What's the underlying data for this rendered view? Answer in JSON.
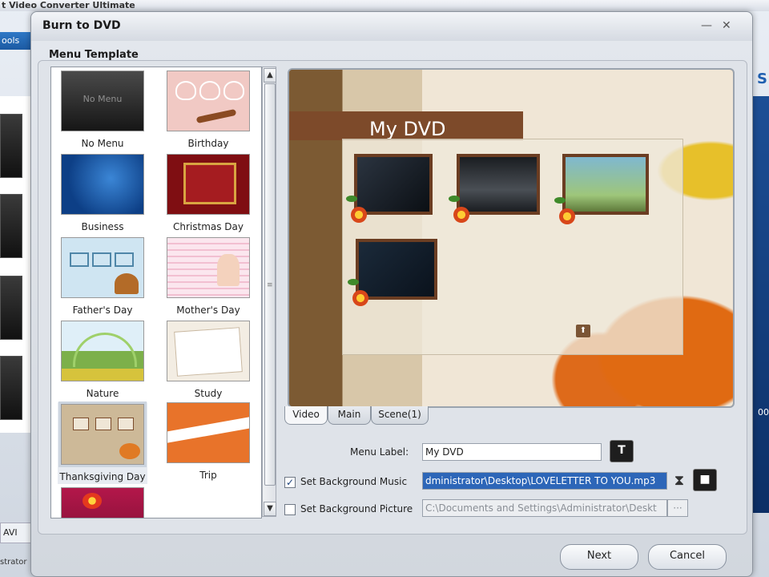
{
  "background_app": {
    "title": "t Video Converter Ultimate",
    "menu_label": "ools",
    "format_label": "AVI",
    "bottom_label": "strator",
    "right_number": "00"
  },
  "dialog": {
    "title": "Burn to DVD",
    "minimize_glyph": "—",
    "close_glyph": "✕",
    "section_title": "Menu Template"
  },
  "templates": [
    {
      "name": "No Menu",
      "thumb_text": "No Menu"
    },
    {
      "name": "Birthday"
    },
    {
      "name": "Business"
    },
    {
      "name": "Christmas Day"
    },
    {
      "name": "Father's Day"
    },
    {
      "name": "Mother's Day"
    },
    {
      "name": "Nature"
    },
    {
      "name": "Study"
    },
    {
      "name": "Thanksgiving Day"
    },
    {
      "name": "Trip"
    }
  ],
  "selected_template": "Thanksgiving Day",
  "scrollbar": {
    "up": "▲",
    "down": "▼"
  },
  "preview": {
    "title": "My DVD",
    "button_glyph": "⬆"
  },
  "tabs": [
    {
      "label": "Video"
    },
    {
      "label": "Main"
    },
    {
      "label": "Scene(1)"
    }
  ],
  "form": {
    "menu_label_label": "Menu Label:",
    "menu_label_value": "My DVD",
    "text_button": "T",
    "bg_music_label": "Set Background Music",
    "bg_music_checked": "✓",
    "bg_music_value": "dministrator\\Desktop\\LOVELETTER TO YOU.mp3",
    "hourglass": "⧗",
    "stop_button": "■",
    "bg_picture_label": "Set Background Picture",
    "bg_picture_value": "C:\\Documents and Settings\\Administrator\\Deskt",
    "bg_picture_browse": "···"
  },
  "buttons": {
    "next": "Next",
    "cancel": "Cancel"
  }
}
